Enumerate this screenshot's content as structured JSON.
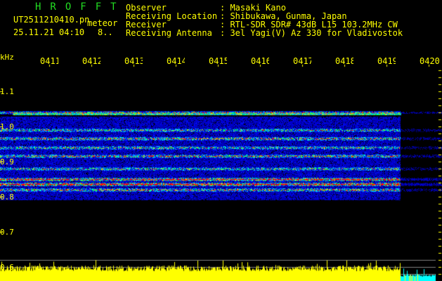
{
  "header": {
    "title": "HROFFT",
    "filename": "UT2511210410.pn",
    "mode": "meteor",
    "datetime": "25.11.21 04:10",
    "extra": "8..",
    "fields": [
      {
        "label": "Observer",
        "value": ": Masaki Kano"
      },
      {
        "label": "Receiving Location",
        "value": ": Shibukawa, Gunma, Japan"
      },
      {
        "label": "Receiver",
        "value": ": RTL-SDR SDR# 43dB L15 103.2MHz CW"
      },
      {
        "label": "Receiving Antenna",
        "value": ": 3el Yagi(V) Az 330 for Vladivostok"
      }
    ]
  },
  "axis": {
    "unit": "kHz",
    "time_ticks": [
      "0411",
      "0412",
      "0413",
      "0414",
      "0415",
      "0416",
      "0417",
      "0418",
      "0419",
      "0420"
    ],
    "freq_ticks": [
      "1.1",
      "1.0",
      "0.9",
      "0.8",
      "0.7",
      "0.6"
    ]
  },
  "colors": {
    "text": "#ffff00",
    "title": "#22dd22",
    "signal_bar": "#ffff00",
    "signal_bar_end": "#00ffff"
  }
}
